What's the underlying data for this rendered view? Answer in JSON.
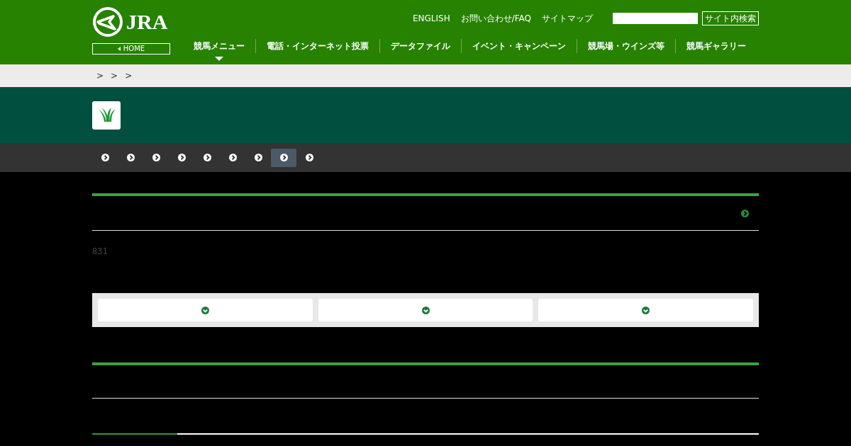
{
  "header": {
    "logo_text": "JRA",
    "home_link": "HOME",
    "utility_links": [
      "ENGLISH",
      "お問い合わせ/FAQ",
      "サイトマップ"
    ],
    "search": {
      "button": "サイト内検索"
    },
    "nav": [
      {
        "label": "競馬メニュー",
        "selected": true
      },
      {
        "label": "電話・インターネット投票",
        "selected": false
      },
      {
        "label": "データファイル",
        "selected": false
      },
      {
        "label": "イベント・キャンペーン",
        "selected": false
      },
      {
        "label": "競馬場・ウインズ等",
        "selected": false
      },
      {
        "label": "競馬ギャラリー",
        "selected": false
      }
    ]
  },
  "breadcrumb": [
    ">",
    ">",
    ">"
  ],
  "subnav": [
    {
      "selected": false
    },
    {
      "selected": false
    },
    {
      "selected": false
    },
    {
      "selected": false
    },
    {
      "selected": false
    },
    {
      "selected": false
    },
    {
      "selected": false
    },
    {
      "selected": true
    },
    {
      "selected": false
    }
  ],
  "count_text": "831"
}
